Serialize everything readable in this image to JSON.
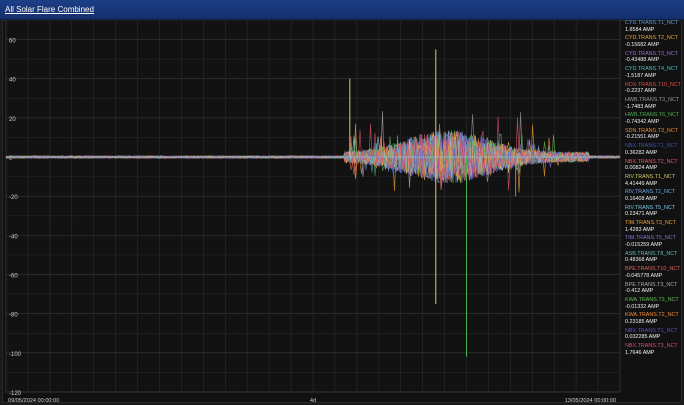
{
  "window": {
    "title": "All Solar Flare Combined"
  },
  "chart_data": {
    "type": "line",
    "yticks": [
      60,
      40,
      20,
      0,
      -20,
      -40,
      -60,
      -80,
      -100,
      -120
    ],
    "ylim": [
      -120,
      70
    ],
    "xticks": [
      "09/05/2024 00:00:00",
      "4d",
      "13/05/2024 00:00:00"
    ],
    "grid": true,
    "series": [
      {
        "name": "CYD.TRANS.T1_NCT",
        "value": "1.8584 AMP",
        "color": "#5b9bd5"
      },
      {
        "name": "CYD.TRANS.T2_NCT",
        "value": "-0.15682 AMP",
        "color": "#e8a33c"
      },
      {
        "name": "CYD.TRANS.T3_NCT",
        "value": "-0.43488 AMP",
        "color": "#9b6fd1"
      },
      {
        "name": "CYD.TRANS.T4_NCT",
        "value": "-1.5187 AMP",
        "color": "#4bc0c0"
      },
      {
        "name": "RDX.TRANS.T10_NCT",
        "value": "-0.2237 AMP",
        "color": "#e04b4b"
      },
      {
        "name": "HWB.TRANS.T3_NCT",
        "value": "-1.7483 AMP",
        "color": "#9a9a9a"
      },
      {
        "name": "HWB.TRANS.T6_NCT",
        "value": "-0.74342 AMP",
        "color": "#4caf50"
      },
      {
        "name": "SDN.TRANS.T3_NCT",
        "value": "-0.21551 AMP",
        "color": "#ef8a2e"
      },
      {
        "name": "NBX.TRANS.T1_NCT",
        "value": "0.36282 AMP",
        "color": "#3f51b5"
      },
      {
        "name": "NBX.TRANS.T2_NCT",
        "value": "0.00824 AMP",
        "color": "#e05a6b"
      },
      {
        "name": "RIV.TRANS.T1_NCT",
        "value": "4.41449 AMP",
        "color": "#d6cc6a"
      },
      {
        "name": "RIV.TRANS.T2_NCT",
        "value": "0.16408 AMP",
        "color": "#6fa8dc"
      },
      {
        "name": "RIV.TRANS.T5_NCT",
        "value": "0.23471 AMP",
        "color": "#7ec8e3"
      },
      {
        "name": "TIM.TRANS.T3_NCT",
        "value": "1.4283 AMP",
        "color": "#f0a030"
      },
      {
        "name": "TIM.TRANS.T5_NCT",
        "value": "-0.015259 AMP",
        "color": "#8e6fd8"
      },
      {
        "name": "ASB.TRANS.T8_NCT",
        "value": "0.48368 AMP",
        "color": "#5fbfb0"
      },
      {
        "name": "BPE.TRANS.T10_NCT",
        "value": "-0.045778 AMP",
        "color": "#e06060"
      },
      {
        "name": "BPE.TRANS.T3_NCT",
        "value": "-0.412 AMP",
        "color": "#aaaaaa"
      },
      {
        "name": "KWA.TRANS.T3_NCT",
        "value": "-0.01332 AMP",
        "color": "#66bb55"
      },
      {
        "name": "KWA.TRANS.T2_NCT",
        "value": "0.23185 AMP",
        "color": "#f28c3c"
      },
      {
        "name": "NBX.TRANS.T1_NCT",
        "value": "0.032285 AMP",
        "color": "#5b4fc9"
      },
      {
        "name": "NBX.TRANS.T3_NCT",
        "value": "1.7646 AMP",
        "color": "#d9506a"
      }
    ]
  }
}
